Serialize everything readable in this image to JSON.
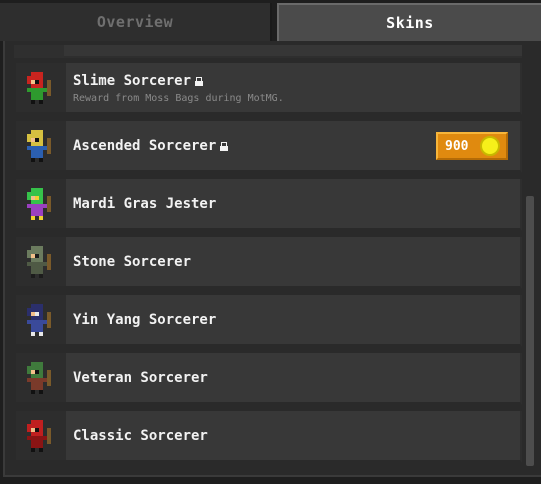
{
  "tabs": [
    {
      "label": "Overview",
      "active": false
    },
    {
      "label": "Skins",
      "active": true
    }
  ],
  "skins": [
    {
      "name": "Slime Sorcerer",
      "locked": true,
      "subtitle": "Reward from Moss Bags during MotMG.",
      "icon": "slime-sorcerer-sprite",
      "colors": {
        "hood": "#c8241f",
        "body": "#2e9a2e",
        "accent": "#111111"
      }
    },
    {
      "name": "Ascended Sorcerer",
      "locked": true,
      "price": "900",
      "icon": "ascended-sorcerer-sprite",
      "colors": {
        "hood": "#d6c040",
        "body": "#2b5fb0",
        "accent": "#111111"
      }
    },
    {
      "name": "Mardi Gras Jester",
      "locked": false,
      "icon": "mardi-gras-jester-sprite",
      "colors": {
        "hood": "#36c24a",
        "body": "#9b3fc0",
        "accent": "#f0d030"
      }
    },
    {
      "name": "Stone Sorcerer",
      "locked": false,
      "icon": "stone-sorcerer-sprite",
      "colors": {
        "hood": "#6b7b5e",
        "body": "#4f5a45",
        "accent": "#1c1c1c"
      }
    },
    {
      "name": "Yin Yang Sorcerer",
      "locked": false,
      "icon": "yin-yang-sorcerer-sprite",
      "colors": {
        "hood": "#2b2f6b",
        "body": "#3a4a9a",
        "accent": "#e8e8e8"
      }
    },
    {
      "name": "Veteran Sorcerer",
      "locked": false,
      "icon": "veteran-sorcerer-sprite",
      "colors": {
        "hood": "#3f7a3c",
        "body": "#7a3a2a",
        "accent": "#111111"
      }
    },
    {
      "name": "Classic Sorcerer",
      "locked": false,
      "icon": "classic-sorcerer-sprite",
      "colors": {
        "hood": "#c01f1f",
        "body": "#8a1414",
        "accent": "#111111"
      }
    }
  ],
  "colors": {
    "price_bg": "#e08a0f",
    "coin": "#f6f01a"
  }
}
